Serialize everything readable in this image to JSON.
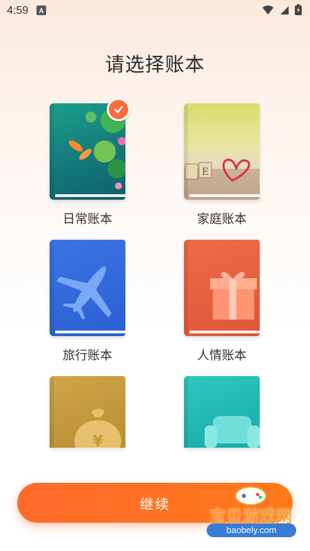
{
  "status_bar": {
    "time": "4:59",
    "notification_icon": "a-badge-icon",
    "icons": [
      "wifi-icon",
      "cellular-signal-icon",
      "battery-charging-icon"
    ]
  },
  "page": {
    "title": "请选择账本"
  },
  "books": [
    {
      "label": "日常账本",
      "theme": "koi-pond",
      "selected": true,
      "color": "#1f8a7a"
    },
    {
      "label": "家庭账本",
      "theme": "love-blocks",
      "selected": false,
      "color": "#c9d36a"
    },
    {
      "label": "旅行账本",
      "theme": "airplane",
      "selected": false,
      "color": "#2f67d8"
    },
    {
      "label": "人情账本",
      "theme": "gift",
      "selected": false,
      "color": "#e7603e"
    },
    {
      "label": "",
      "theme": "money-bag",
      "selected": false,
      "color": "#c39a3c"
    },
    {
      "label": "",
      "theme": "sofa",
      "selected": false,
      "color": "#1fb9b2"
    }
  ],
  "continue_button": {
    "label": "继续"
  },
  "watermark": {
    "text": "宝贝游戏网",
    "domain": "baobely.com"
  },
  "colors": {
    "accent": "#ff6a3d",
    "button": "#ff7a1a"
  }
}
